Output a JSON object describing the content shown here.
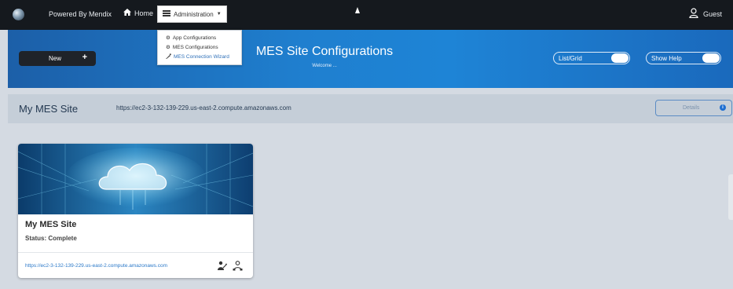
{
  "topnav": {
    "powered_by": "Powered By Mendix",
    "home": "Home",
    "administration": "Administration",
    "guest": "Guest"
  },
  "admin_menu": [
    {
      "label": "App Configurations",
      "icon": "gear-icon"
    },
    {
      "label": "MES Configurations",
      "icon": "gear-icon"
    },
    {
      "label": "MES Connection Wizard",
      "icon": "wizard-icon"
    }
  ],
  "banner": {
    "new_button": "New",
    "title": "MES Site Configurations",
    "welcome": "Welcome ...",
    "list_grid_toggle": "List/Grid",
    "show_help_toggle": "Show Help"
  },
  "site": {
    "name": "My MES Site",
    "url": "https://ec2-3-132-139-229.us-east-2.compute.amazonaws.com",
    "details_button": "Details"
  },
  "card": {
    "title": "My MES Site",
    "status": "Status: Complete",
    "link": "https://ec2-3-132-139-229.us-east-2.compute.amazonaws.com",
    "icons": [
      "wizard-icon",
      "network-icon"
    ]
  },
  "colors": {
    "nav_bg": "#15191e",
    "banner_blue": "#1f7fcf",
    "page_bg": "#d4dae2",
    "link": "#2a78c8"
  }
}
